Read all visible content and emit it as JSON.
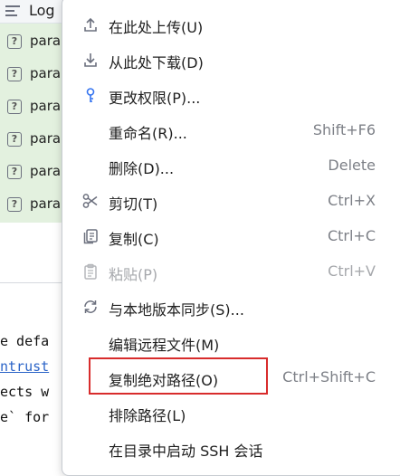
{
  "background": {
    "tree_header": "Log",
    "tree_rows": [
      "para",
      "para",
      "para",
      "para",
      "para",
      "para"
    ],
    "code_lines": [
      "e defa",
      "ntrust",
      "ects w",
      "e` for"
    ]
  },
  "menu": {
    "items": [
      {
        "label": "在此处上传(U)",
        "shortcut": "",
        "icon": "upload-icon"
      },
      {
        "label": "从此处下载(D)",
        "shortcut": "",
        "icon": "download-icon"
      },
      {
        "label": "更改权限(P)...",
        "shortcut": "",
        "icon": "key-icon"
      },
      {
        "label": "重命名(R)...",
        "shortcut": "Shift+F6",
        "icon": ""
      },
      {
        "label": "删除(D)...",
        "shortcut": "Delete",
        "icon": ""
      },
      {
        "label": "剪切(T)",
        "shortcut": "Ctrl+X",
        "icon": "scissors-icon"
      },
      {
        "label": "复制(C)",
        "shortcut": "Ctrl+C",
        "icon": "copy-icon"
      },
      {
        "label": "粘贴(P)",
        "shortcut": "Ctrl+V",
        "icon": "clipboard-icon",
        "disabled": true
      },
      {
        "label": "与本地版本同步(S)...",
        "shortcut": "",
        "icon": "sync-icon"
      },
      {
        "label": "编辑远程文件(M)",
        "shortcut": "",
        "icon": ""
      },
      {
        "label": "复制绝对路径(O)",
        "shortcut": "Ctrl+Shift+C",
        "icon": "",
        "highlighted": true
      },
      {
        "label": "排除路径(L)",
        "shortcut": "",
        "icon": ""
      },
      {
        "label": "在目录中启动 SSH 会话",
        "shortcut": "",
        "icon": ""
      }
    ]
  },
  "colors": {
    "highlight_border": "#d82c2c",
    "tree_background": "#e3f1df",
    "shortcut_text": "#7d8087",
    "link_text": "#2a63c7"
  }
}
